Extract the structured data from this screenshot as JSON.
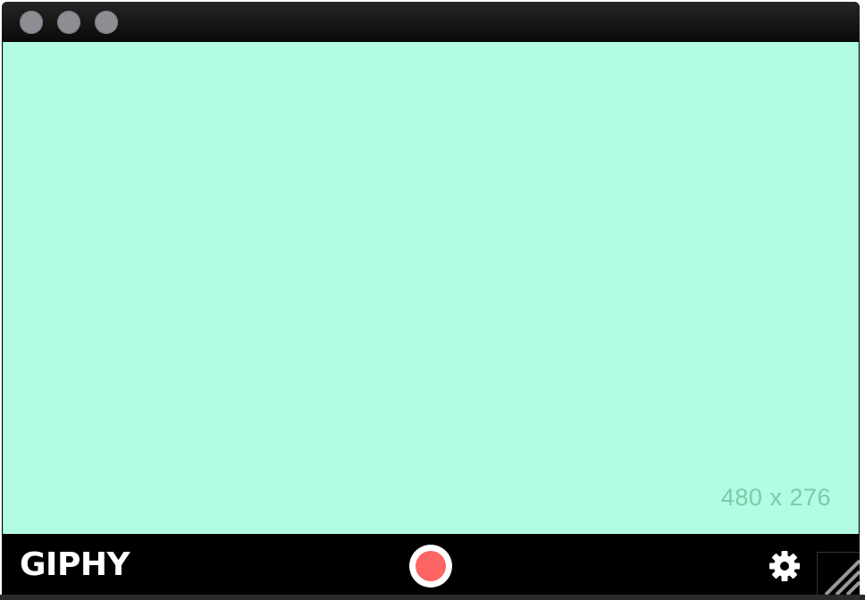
{
  "window": {
    "controls": [
      "close",
      "minimize",
      "zoom"
    ]
  },
  "capture": {
    "dimensions_label": "480 x 276",
    "background_color": "#b2fce4"
  },
  "toolbar": {
    "logo_text": "GIPHY",
    "record_color": "#fd6565",
    "settings_icon": "gear-icon",
    "resize_icon": "resize-grip-icon"
  }
}
